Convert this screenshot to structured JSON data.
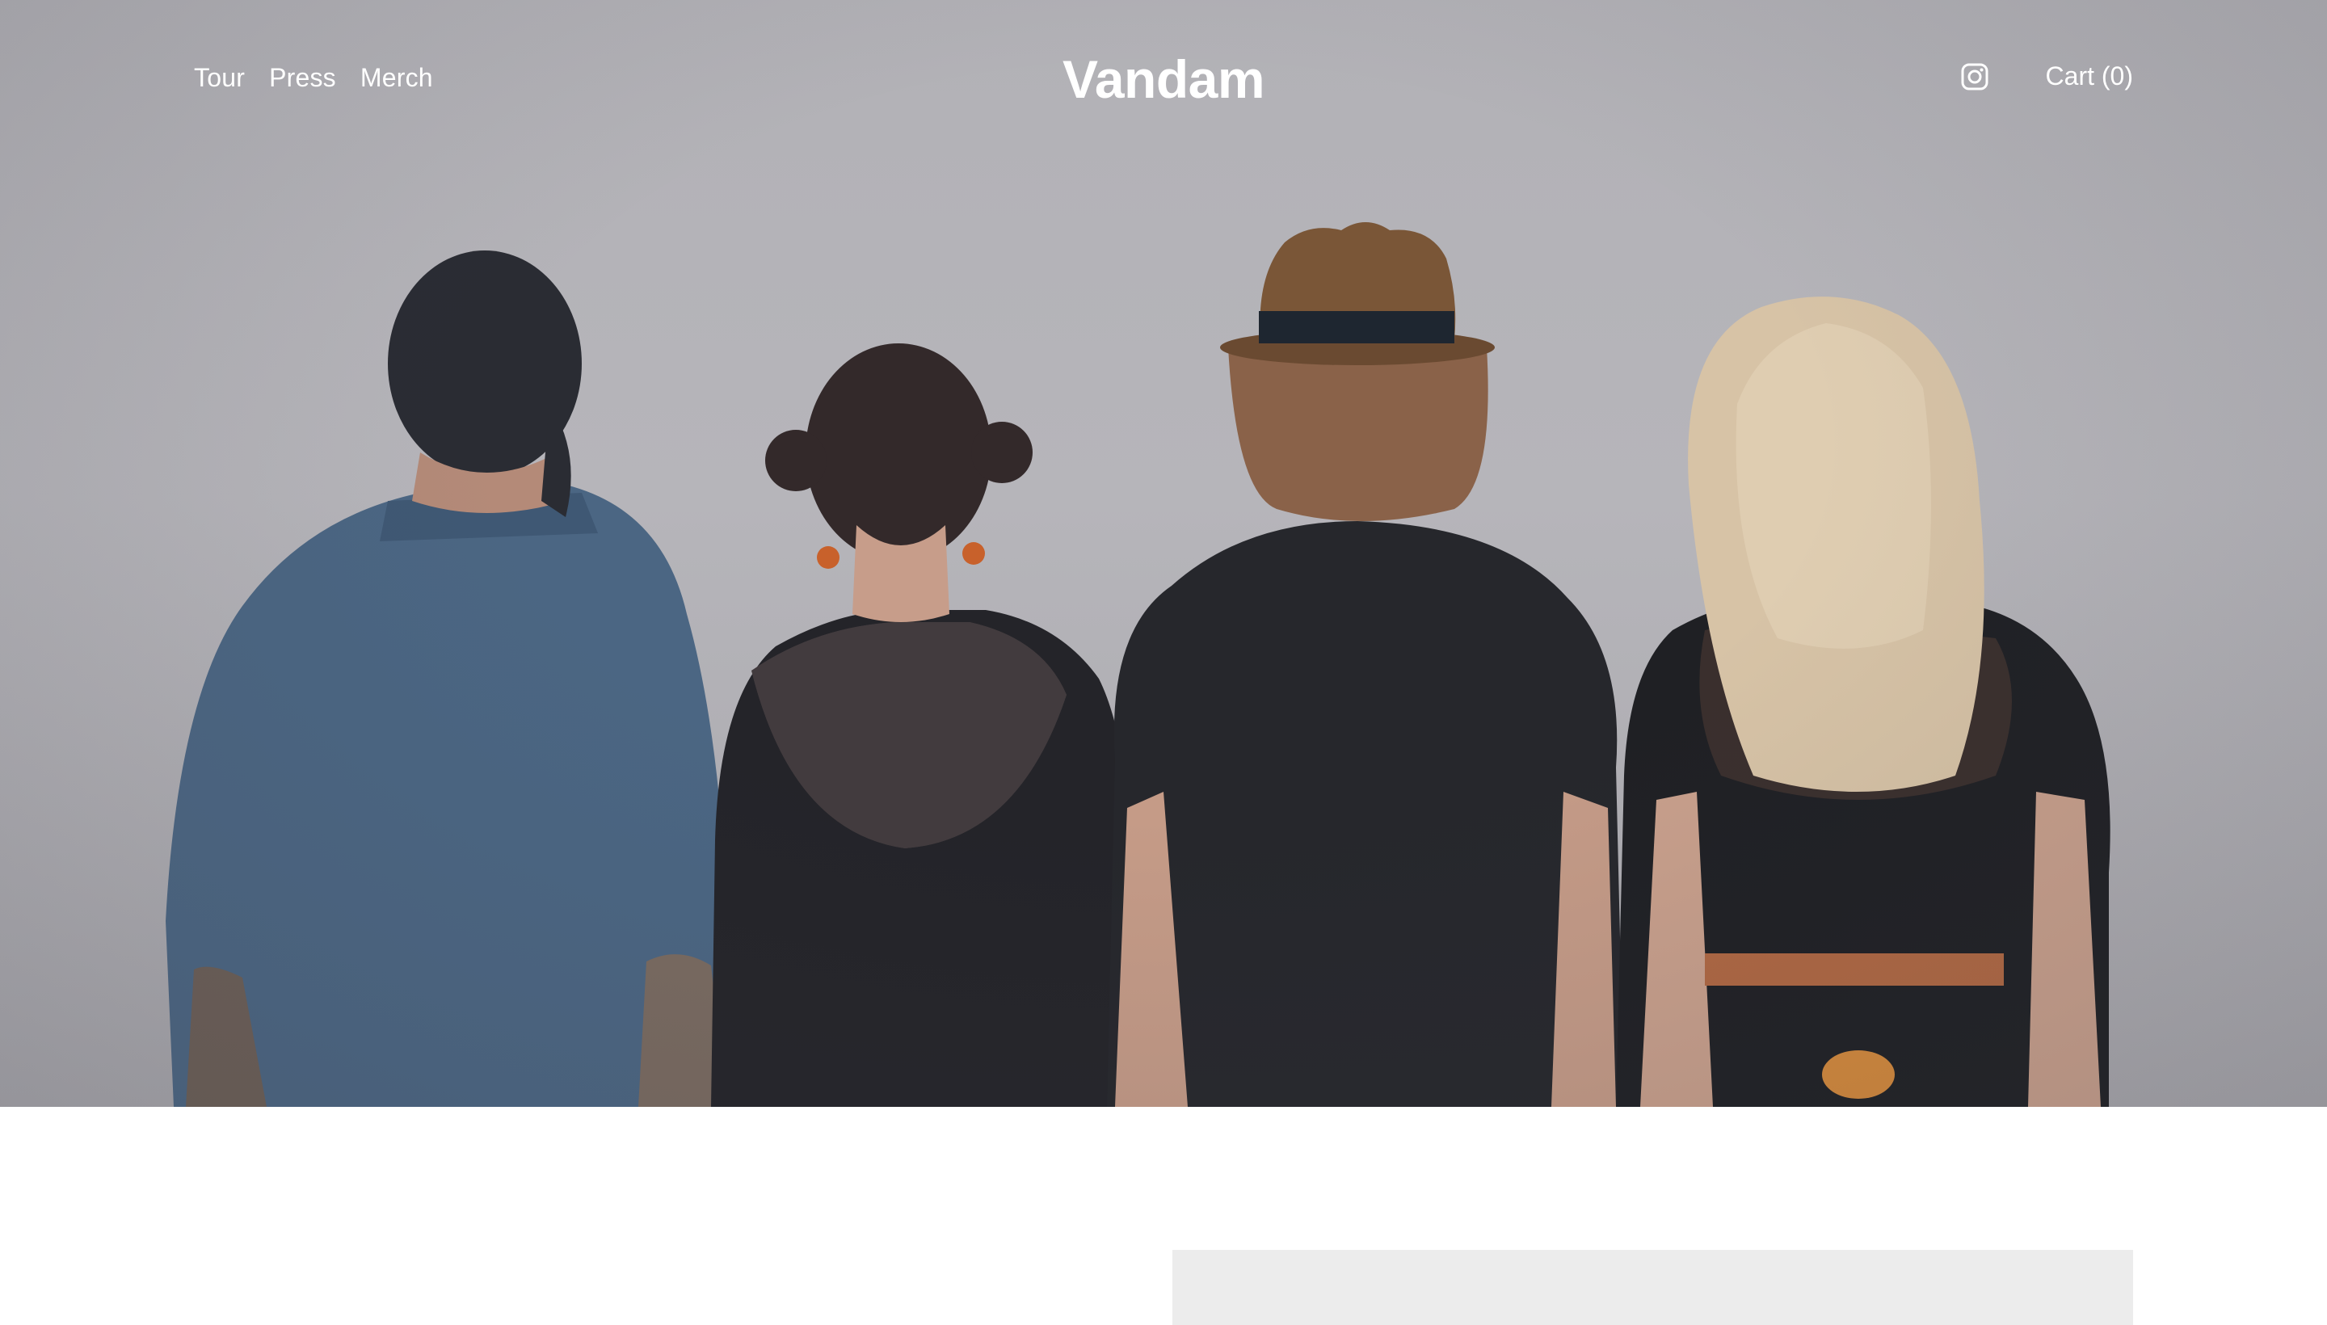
{
  "header": {
    "nav_left": [
      {
        "label": "Tour"
      },
      {
        "label": "Press"
      },
      {
        "label": "Merch"
      }
    ],
    "site_title": "Vandam",
    "social_icon": "instagram-icon",
    "cart_label": "Cart (0)"
  },
  "hero": {
    "image": "band-members-from-behind-photo"
  },
  "colors": {
    "header_text": "#ffffff",
    "hero_background": "#b4b3b8",
    "placeholder_block": "#ececec"
  }
}
